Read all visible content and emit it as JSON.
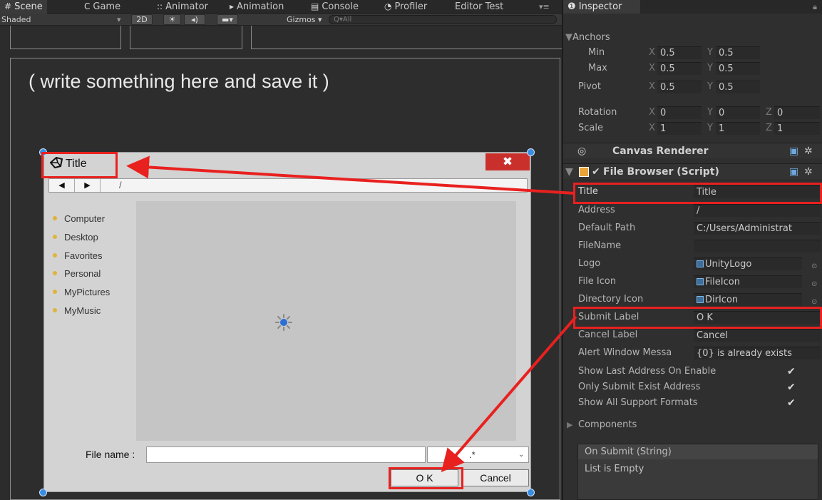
{
  "scene_tabs": [
    {
      "icon": "#",
      "label": "Scene"
    },
    {
      "icon": "C",
      "label": "Game"
    },
    {
      "icon": "::",
      "label": "Animator"
    },
    {
      "icon": "▸",
      "label": "Animation"
    },
    {
      "icon": "▤",
      "label": "Console"
    },
    {
      "icon": "◔",
      "label": "Profiler"
    },
    {
      "icon": "",
      "label": "Editor Test"
    }
  ],
  "toolbar": {
    "shading_mode": "Shaded",
    "mode_2d": "2D",
    "gizmos": "Gizmos",
    "search_placeholder": "Q▾All"
  },
  "game": {
    "placeholder_text": "( write something here and save it )"
  },
  "dialog": {
    "title": "Title",
    "close_glyph": "✖",
    "back_glyph": "◀",
    "forward_glyph": "▶",
    "address": "/",
    "locations": [
      "Computer",
      "Desktop",
      "Favorites",
      "Personal",
      "MyPictures",
      "MyMusic"
    ],
    "filename_label": "File name :",
    "filename_value": "",
    "filter_value": ".*",
    "ok_label": "O K",
    "cancel_label": "Cancel"
  },
  "inspector": {
    "tab_label": "Inspector",
    "anchors_label": "Anchors",
    "anchor_min_label": "Min",
    "anchor_min_x": "0.5",
    "anchor_min_y": "0.5",
    "anchor_max_label": "Max",
    "anchor_max_x": "0.5",
    "anchor_max_y": "0.5",
    "pivot_label": "Pivot",
    "pivot_x": "0.5",
    "pivot_y": "0.5",
    "rotation_label": "Rotation",
    "rotation": {
      "x": "0",
      "y": "0",
      "z": "0"
    },
    "scale_label": "Scale",
    "scale": {
      "x": "1",
      "y": "1",
      "z": "1"
    },
    "canvas_renderer_title": "Canvas Renderer",
    "file_browser_title": "File Browser (Script)",
    "fields": {
      "title": {
        "label": "Title",
        "value": "Title"
      },
      "address": {
        "label": "Address",
        "value": "/"
      },
      "default_path": {
        "label": "Default Path",
        "value": "C:/Users/Administrat"
      },
      "file_name": {
        "label": "FileName",
        "value": ""
      },
      "logo": {
        "label": "Logo",
        "value": "UnityLogo"
      },
      "file_icon": {
        "label": "File Icon",
        "value": "FileIcon"
      },
      "directory_icon": {
        "label": "Directory Icon",
        "value": "DirIcon"
      },
      "submit_label": {
        "label": "Submit Label",
        "value": "O K"
      },
      "cancel_label": {
        "label": "Cancel Label",
        "value": "Cancel"
      },
      "alert_message": {
        "label": "Alert Window Messa",
        "value": "{0} is already exists"
      }
    },
    "toggles": {
      "show_last_address": {
        "label": "Show Last Address On Enable",
        "checked": true
      },
      "only_submit_exist": {
        "label": "Only Submit Exist Address",
        "checked": true
      },
      "show_all_formats": {
        "label": "Show All Support Formats",
        "checked": true
      }
    },
    "components_label": "Components",
    "on_submit_header": "On Submit (String)",
    "on_submit_empty": "List is Empty"
  },
  "axes": {
    "x": "X",
    "y": "Y",
    "z": "Z"
  },
  "colors": {
    "highlight": "#e8211f",
    "handle": "#3a8de0",
    "close": "#c9302c"
  }
}
